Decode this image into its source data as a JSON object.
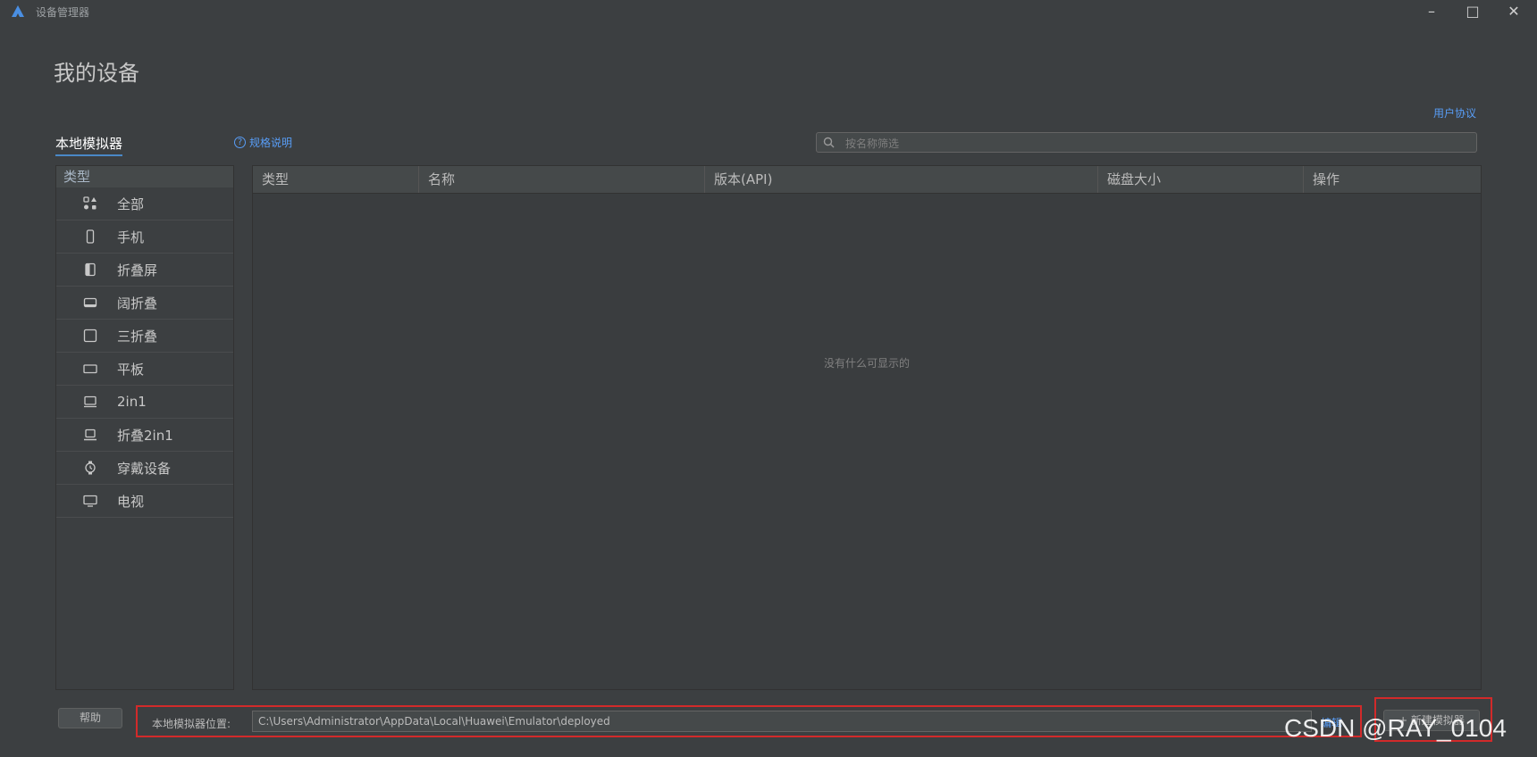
{
  "window": {
    "title": "设备管理器",
    "logo_icon": "huawei-devtools-logo-icon",
    "controls": [
      "minimize-icon",
      "maximize-icon",
      "close-icon"
    ]
  },
  "page": {
    "title": "我的设备",
    "agreement_link": "用户协议"
  },
  "tabs": {
    "local": "本地模拟器"
  },
  "spec_link": {
    "label": "规格说明",
    "icon": "help-circle-icon"
  },
  "search": {
    "placeholder": "按名称筛选",
    "icon": "search-icon"
  },
  "sidebar": {
    "header": "类型",
    "items": [
      {
        "label": "全部",
        "icon": "all-grid-icon"
      },
      {
        "label": "手机",
        "icon": "phone-icon"
      },
      {
        "label": "折叠屏",
        "icon": "foldable-icon"
      },
      {
        "label": "阔折叠",
        "icon": "wide-fold-icon"
      },
      {
        "label": "三折叠",
        "icon": "tri-fold-icon"
      },
      {
        "label": "平板",
        "icon": "tablet-icon"
      },
      {
        "label": "2in1",
        "icon": "two-in-one-icon"
      },
      {
        "label": "折叠2in1",
        "icon": "laptop-icon"
      },
      {
        "label": "穿戴设备",
        "icon": "watch-icon"
      },
      {
        "label": "电视",
        "icon": "tv-icon"
      }
    ]
  },
  "table": {
    "columns": [
      "类型",
      "名称",
      "版本(API)",
      "磁盘大小",
      "操作"
    ],
    "rows": [],
    "empty_text": "没有什么可显示的"
  },
  "footer": {
    "help_button": "帮助",
    "location_label": "本地模拟器位置:",
    "location_value": "C:\\Users\\Administrator\\AppData\\Local\\Huawei\\Emulator\\deployed",
    "edit_link": "编辑",
    "new_button": "+ 新建模拟器"
  },
  "watermark": "CSDN @RAY_0104",
  "colors": {
    "background": "#3c3f41",
    "link": "#589df6",
    "highlight_box": "#d22a2a",
    "tab_underline": "#4a88c7"
  }
}
